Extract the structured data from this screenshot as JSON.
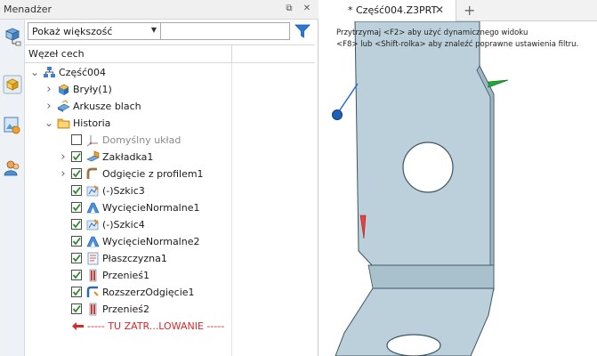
{
  "panel": {
    "title": "Menadżer",
    "pin_glyph": "⧉",
    "close_glyph": "✕"
  },
  "filter": {
    "dropdown_value": "Pokaż większość",
    "search_value": ""
  },
  "tree_header": {
    "column1": "Węzeł cech"
  },
  "tree": [
    {
      "label": "Część004",
      "icon": "part-assembly-icon",
      "expander": "collapse",
      "checkbox": "none",
      "style": "normal"
    },
    {
      "label": "Bryły(1)",
      "icon": "solids-icon",
      "expander": "expand",
      "checkbox": "none",
      "style": "normal"
    },
    {
      "label": "Arkusze blach",
      "icon": "sheets-icon",
      "expander": "expand",
      "checkbox": "none",
      "style": "normal"
    },
    {
      "label": "Historia",
      "icon": "history-folder-icon",
      "expander": "collapse",
      "checkbox": "none",
      "style": "normal"
    },
    {
      "label": "Domyślny układ",
      "icon": "default-csys-icon",
      "expander": "none",
      "checkbox": "unchecked",
      "style": "gray"
    },
    {
      "label": "Zakładka1",
      "icon": "flange-icon",
      "expander": "expand",
      "checkbox": "checked",
      "style": "normal"
    },
    {
      "label": "Odgięcie z profilem1",
      "icon": "profile-bend-icon",
      "expander": "expand",
      "checkbox": "checked",
      "style": "normal"
    },
    {
      "label": "(-)Szkic3",
      "icon": "sketch-icon",
      "expander": "none",
      "checkbox": "checked",
      "style": "normal"
    },
    {
      "label": "WycięcieNormalne1",
      "icon": "normal-cut-icon",
      "expander": "none",
      "checkbox": "checked",
      "style": "normal"
    },
    {
      "label": "(-)Szkic4",
      "icon": "sketch-icon",
      "expander": "none",
      "checkbox": "checked",
      "style": "normal"
    },
    {
      "label": "WycięcieNormalne2",
      "icon": "normal-cut-icon",
      "expander": "none",
      "checkbox": "checked",
      "style": "normal"
    },
    {
      "label": "Płaszczyzna1",
      "icon": "plane-icon",
      "expander": "none",
      "checkbox": "checked",
      "style": "normal"
    },
    {
      "label": "Przenieś1",
      "icon": "move-icon",
      "expander": "none",
      "checkbox": "checked",
      "style": "normal"
    },
    {
      "label": "RozszerzOdgięcie1",
      "icon": "extend-bend-icon",
      "expander": "none",
      "checkbox": "checked",
      "style": "normal"
    },
    {
      "label": "Przenieś2",
      "icon": "move-icon",
      "expander": "none",
      "checkbox": "checked",
      "style": "normal"
    },
    {
      "label": "----- TU ZATR...LOWANIE -----",
      "icon": "rollback-arrow-icon",
      "expander": "none",
      "checkbox": "none",
      "style": "red"
    }
  ],
  "viewport": {
    "tab_label": "* Część004.Z3PRT",
    "tab_close_glyph": "✕",
    "new_tab_glyph": "+",
    "hint_line1": "Przytrzymaj <F2> aby użyć dynamicznego widoku",
    "hint_line2": "<F8> lub <Shift-rolka> aby znaleźć poprawne ustawienia filtru."
  },
  "colors": {
    "part_fill": "#bcd0db",
    "part_edge": "#3d5663",
    "check_green": "#2e8b2e",
    "accent_blue": "#1e6fd0",
    "rollback_red": "#d42a2a"
  }
}
